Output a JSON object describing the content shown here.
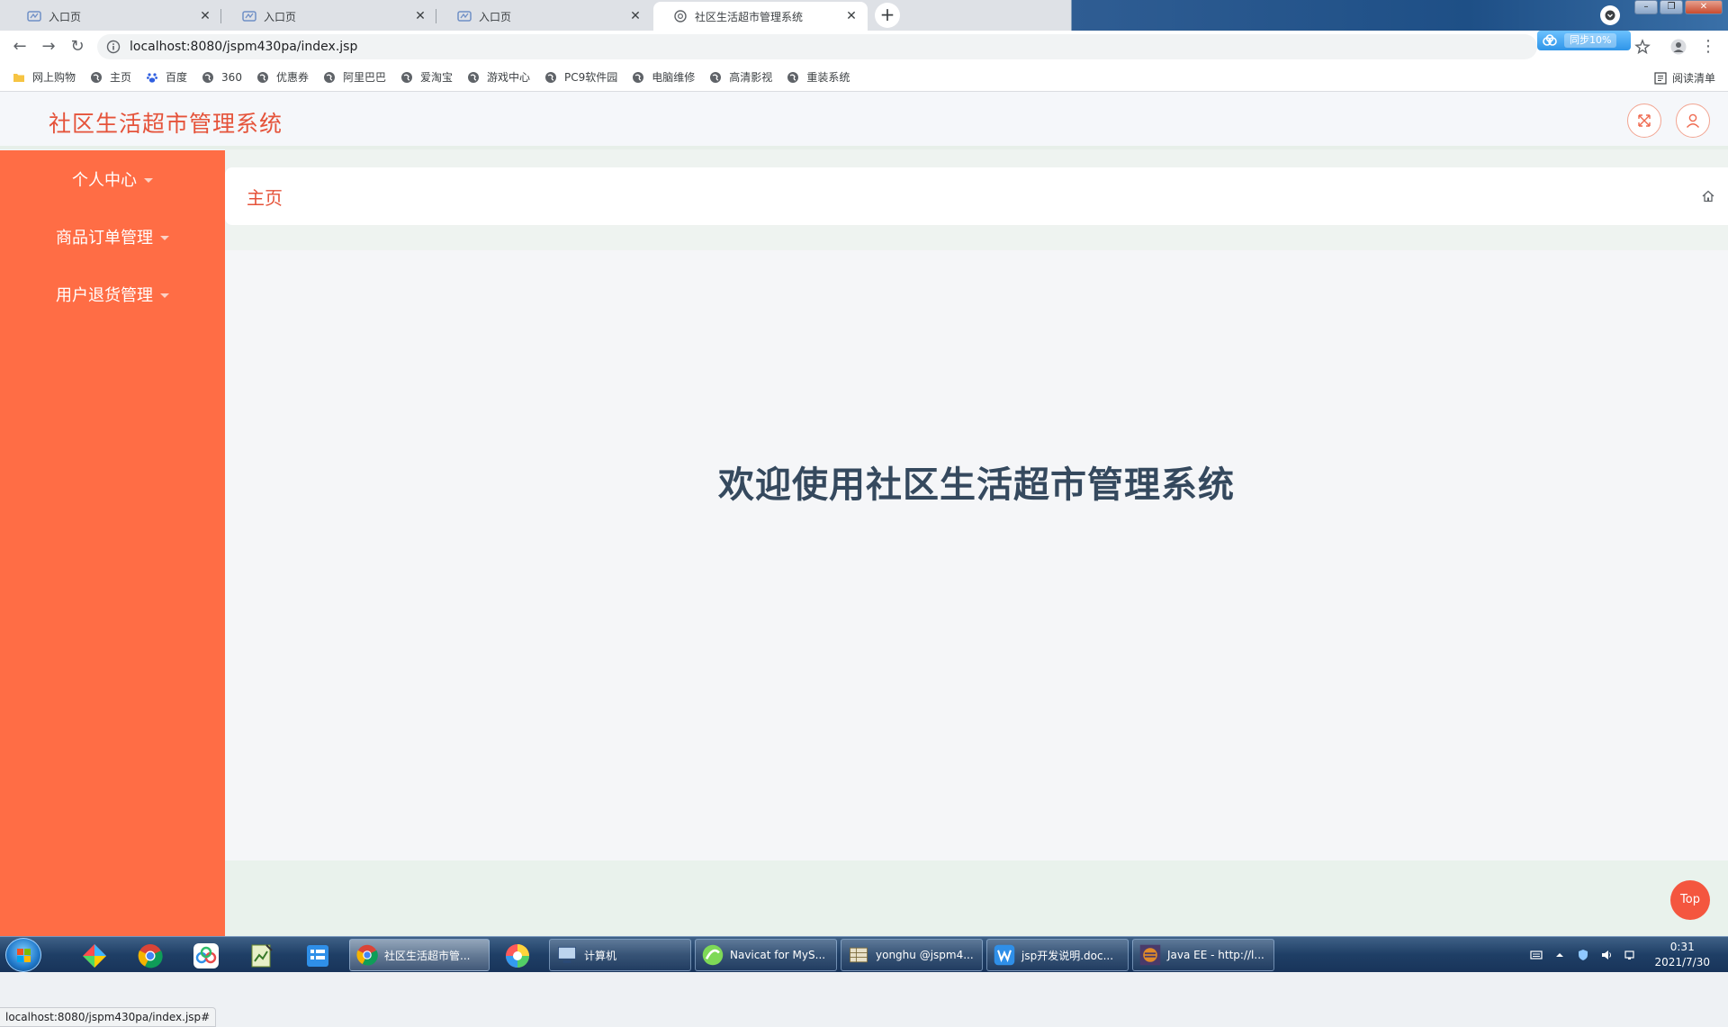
{
  "browser": {
    "tabs": [
      {
        "title": "入口页",
        "active": false
      },
      {
        "title": "入口页",
        "active": false
      },
      {
        "title": "入口页",
        "active": false
      },
      {
        "title": "社区生活超市管理系统",
        "active": true
      }
    ],
    "url": "localhost:8080/jspm430pa/index.jsp",
    "status_url": "localhost:8080/jspm430pa/index.jsp#",
    "bookmarks": [
      "网上购物",
      "主页",
      "百度",
      "360",
      "优惠券",
      "阿里巴巴",
      "爱淘宝",
      "游戏中心",
      "PC9软件园",
      "电脑维修",
      "高清影视",
      "重装系统"
    ],
    "reading_list": "阅读清单",
    "ext_badge": "同步10%"
  },
  "app": {
    "title": "社区生活超市管理系统",
    "menu": [
      {
        "label": "个人中心"
      },
      {
        "label": "商品订单管理"
      },
      {
        "label": "用户退货管理"
      }
    ],
    "breadcrumb": "主页",
    "welcome": "欢迎使用社区生活超市管理系统",
    "top_button": "Top",
    "accent_color": "#ff6d45",
    "title_color": "#e5533a"
  },
  "taskbar": {
    "tasks": [
      "社区生活超市管...",
      "计算机",
      "Navicat for MyS...",
      "yonghu @jspm4...",
      "jsp开发说明.doc...",
      "Java EE - http://l..."
    ],
    "time": "0:31",
    "date": "2021/7/30"
  }
}
